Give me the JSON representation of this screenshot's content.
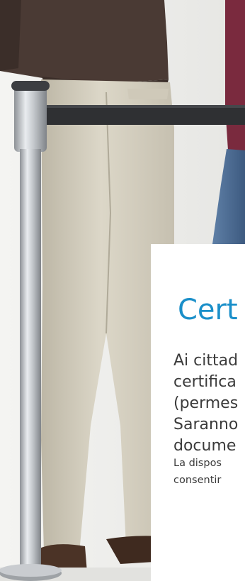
{
  "hero": {
    "image_subject": "people-in-queue-behind-retractable-belt-barrier"
  },
  "card": {
    "title": "Cert",
    "body_lines": [
      "Ai cittad",
      "certifica",
      "(permes",
      "Saranno",
      "docume"
    ],
    "note_lines": [
      "La dispos",
      "consentir"
    ]
  },
  "colors": {
    "accent": "#1a8fc9",
    "text": "#3b3b3b",
    "card_bg": "#ffffff",
    "page_bg": "#eeeeec"
  }
}
